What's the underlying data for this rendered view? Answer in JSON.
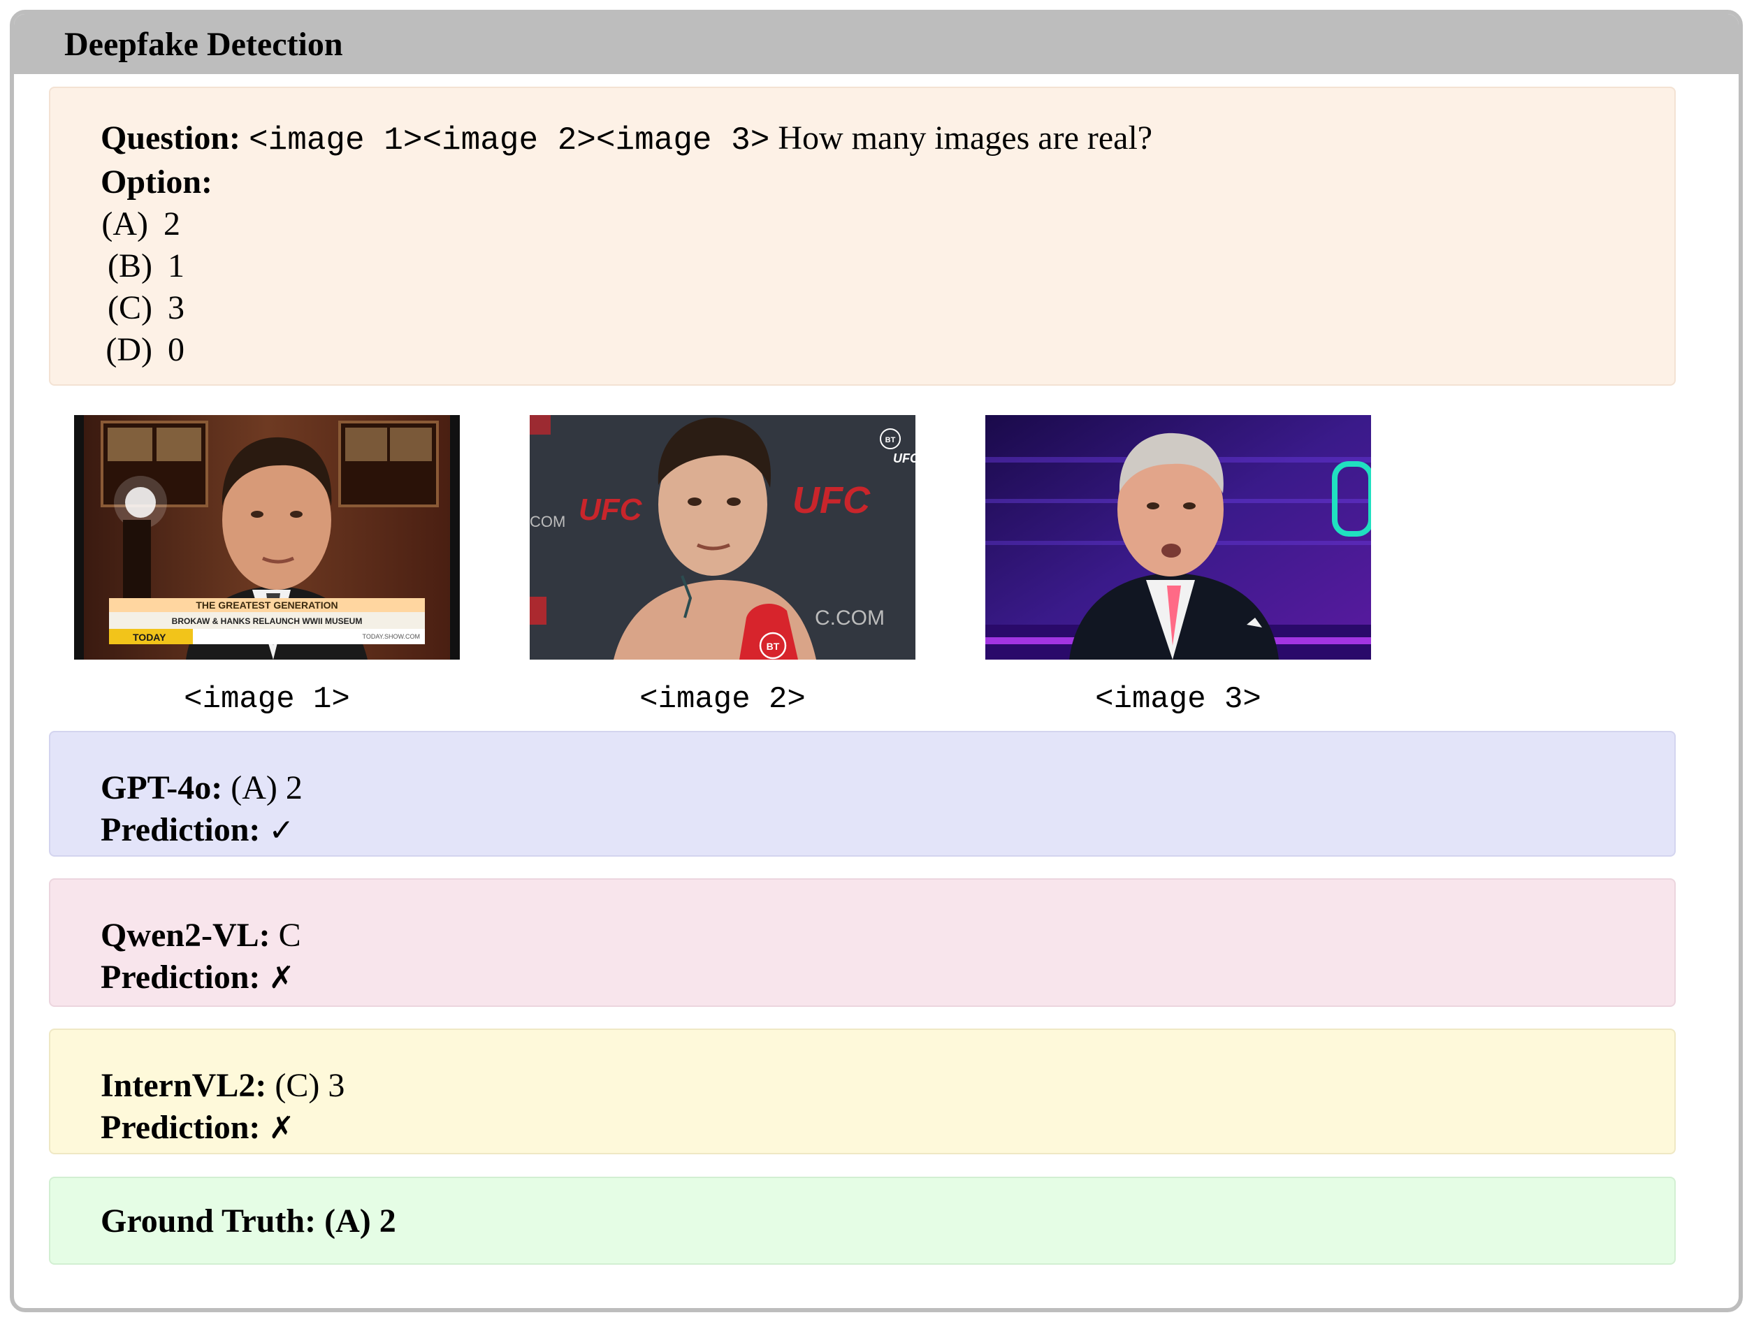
{
  "header": {
    "title": "Deepfake Detection"
  },
  "question": {
    "label": "Question:",
    "image_tags": "<image 1><image 2><image 3>",
    "text": "How many images are real?",
    "option_label": "Option:",
    "options": [
      {
        "letter": "(A)",
        "value": "2"
      },
      {
        "letter": "(B)",
        "value": "1"
      },
      {
        "letter": "(C)",
        "value": "3"
      },
      {
        "letter": "(D)",
        "value": "0"
      }
    ]
  },
  "images": [
    {
      "caption": "<image 1>",
      "ticker_line1": "THE GREATEST GENERATION",
      "ticker_line2": "BROKAW & HANKS RELAUNCH WWII MUSEUM",
      "ticker_brand": "TODAY",
      "ticker_site": "TODAY.SHOW.COM"
    },
    {
      "caption": "<image 2>",
      "logo_text": "UFC",
      "com_text": "COM",
      "site_text": "C.COM",
      "badge_text": "BT",
      "corner_text": "UFC"
    },
    {
      "caption": "<image 3>"
    }
  ],
  "models": [
    {
      "name": "GPT-4o:",
      "answer": "(A) 2",
      "prediction_label": "Prediction:",
      "mark": "✓"
    },
    {
      "name": "Qwen2-VL:",
      "answer": "C",
      "prediction_label": "Prediction:",
      "mark": "✗"
    },
    {
      "name": "InternVL2:",
      "answer": "(C) 3",
      "prediction_label": "Prediction:",
      "mark": "✗"
    }
  ],
  "ground_truth": {
    "label": "Ground Truth:",
    "answer": "(A) 2"
  },
  "colors": {
    "header_bg": "#bdbdbd",
    "question_bg": "#fdf1e6",
    "gpt_bg": "#e3e4f9",
    "qwen_bg": "#f8e5ec",
    "intern_bg": "#fef9da",
    "truth_bg": "#e5fde5"
  }
}
